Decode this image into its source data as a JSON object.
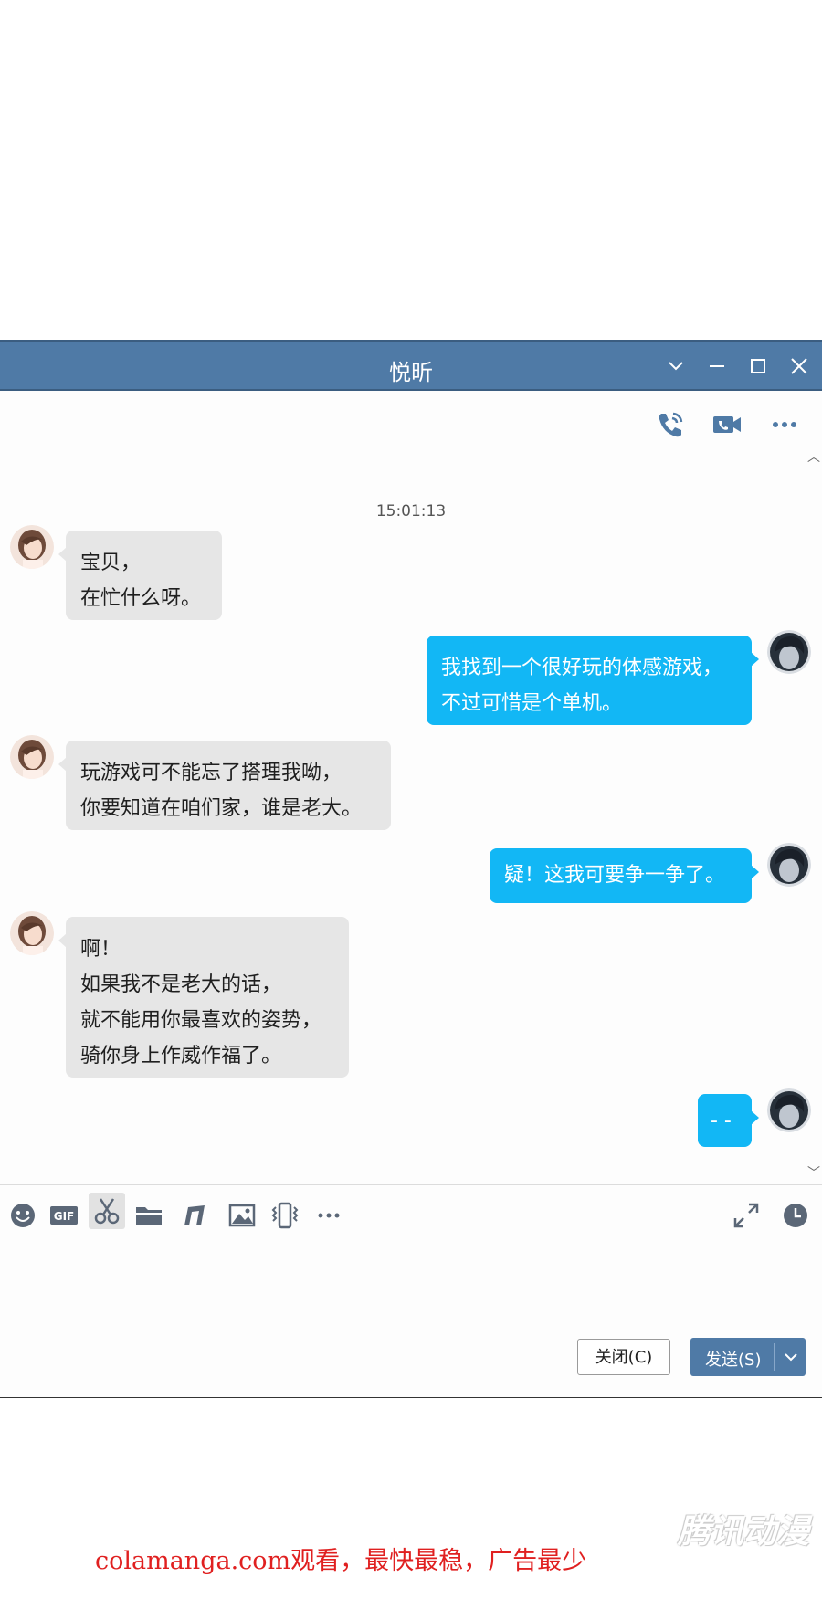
{
  "window": {
    "title": "悦昕",
    "accent_color": "#4f7aa6",
    "controls": [
      "chevron-down-icon",
      "minimize-icon",
      "maximize-icon",
      "close-icon"
    ]
  },
  "top_actions": [
    "phone-call-icon",
    "video-call-icon",
    "more-icon"
  ],
  "conversation": {
    "timestamp": "15:01:13",
    "messages": [
      {
        "from": "her",
        "lines": [
          "宝贝，",
          "在忙什么呀。"
        ]
      },
      {
        "from": "me",
        "lines": [
          "我找到一个很好玩的体感游戏，",
          "不过可惜是个单机。"
        ]
      },
      {
        "from": "her",
        "lines": [
          "玩游戏可不能忘了搭理我呦，",
          "你要知道在咱们家，谁是老大。"
        ]
      },
      {
        "from": "me",
        "lines": [
          "疑！这我可要争一争了。"
        ]
      },
      {
        "from": "her",
        "lines": [
          "啊！",
          "如果我不是老大的话，",
          "就不能用你最喜欢的姿势，",
          "骑你身上作威作福了。"
        ]
      },
      {
        "from": "me",
        "lines": [
          "- -"
        ]
      }
    ],
    "incoming_bubble_color": "#e6e6e6",
    "outgoing_bubble_color": "#12b7f5"
  },
  "input_toolbar": [
    "emoji-icon",
    "gif-icon",
    "scissors-icon",
    "folder-icon",
    "music-icon",
    "image-icon",
    "vibrate-icon",
    "more-icon",
    "expand-icon",
    "history-clock-icon"
  ],
  "buttons": {
    "close_label": "关闭(C)",
    "send_label": "发送(S)"
  },
  "watermark": "腾讯动漫",
  "promo_text": "colamanga.com观看，最快最稳，广告最少"
}
